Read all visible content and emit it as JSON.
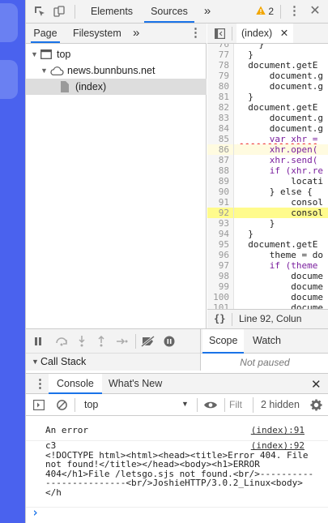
{
  "toolbar": {
    "tabs": [
      "Elements",
      "Sources"
    ],
    "active_tab": "Sources",
    "more": "»",
    "warning_count": "2"
  },
  "navigator": {
    "tabs": [
      "Page",
      "Filesystem"
    ],
    "active_tab": "Page",
    "more": "»",
    "tree": [
      {
        "label": "top",
        "level": 0
      },
      {
        "label": "news.bunnbuns.net",
        "level": 1
      },
      {
        "label": "(index)",
        "level": 2,
        "selected": true
      }
    ]
  },
  "editor": {
    "tab_label": "(index)",
    "highlighted_line": 92,
    "execution_line": 86,
    "lines": [
      {
        "n": "76",
        "text": "    }"
      },
      {
        "n": "77",
        "text": "  }"
      },
      {
        "n": "78",
        "text": "  document.getE"
      },
      {
        "n": "79",
        "text": "      document.g"
      },
      {
        "n": "80",
        "text": "      document.g"
      },
      {
        "n": "81",
        "text": "  }"
      },
      {
        "n": "82",
        "text": "  document.getE"
      },
      {
        "n": "83",
        "text": "      document.g"
      },
      {
        "n": "84",
        "text": "      document.g"
      },
      {
        "n": "85",
        "text": "      var xhr ="
      },
      {
        "n": "86",
        "text": "      xhr.open("
      },
      {
        "n": "87",
        "text": "      xhr.send("
      },
      {
        "n": "88",
        "text": "      if (xhr.re"
      },
      {
        "n": "89",
        "text": "          locati"
      },
      {
        "n": "90",
        "text": "      } else {"
      },
      {
        "n": "91",
        "text": "          consol"
      },
      {
        "n": "92",
        "text": "          consol"
      },
      {
        "n": "93",
        "text": "      }"
      },
      {
        "n": "94",
        "text": "  }"
      },
      {
        "n": "95",
        "text": "  document.getE"
      },
      {
        "n": "96",
        "text": "      theme = do"
      },
      {
        "n": "97",
        "text": "      if (theme"
      },
      {
        "n": "98",
        "text": "          docume"
      },
      {
        "n": "99",
        "text": "          docume"
      },
      {
        "n": "100",
        "text": "          docume"
      },
      {
        "n": "101",
        "text": "          docume"
      }
    ],
    "status_icon": "{}",
    "status_text": "Line 92, Colun"
  },
  "debugger": {
    "callstack_label": "Call Stack",
    "scope_tabs": [
      "Scope",
      "Watch"
    ],
    "active_scope_tab": "Scope",
    "not_paused": "Not paused"
  },
  "drawer": {
    "tabs": [
      "Console",
      "What's New"
    ],
    "active_tab": "Console"
  },
  "console_toolbar": {
    "context": "top",
    "filter_placeholder": "Filt",
    "hidden_count": "2 hidden"
  },
  "console": {
    "messages": [
      {
        "text": "An error",
        "source": "(index):91"
      },
      {
        "text": "c3\n<!DOCTYPE html><html><head><title>Error 404. File\nnot found!</title></head><body><h1>ERROR\n404</h1>File /letsgo.sjs not found.<br/>----------\n---------------<br/>JoshieHTTP/3.0.2_Linux<body>\n</h",
        "source": "(index):92"
      }
    ],
    "prompt": "›"
  },
  "colors": {
    "page_strip": "#4a62ee",
    "accent": "#1a73e8",
    "warning": "#f2a600",
    "line_highlight": "#fffb8c",
    "prompt": "#1a73e8"
  }
}
